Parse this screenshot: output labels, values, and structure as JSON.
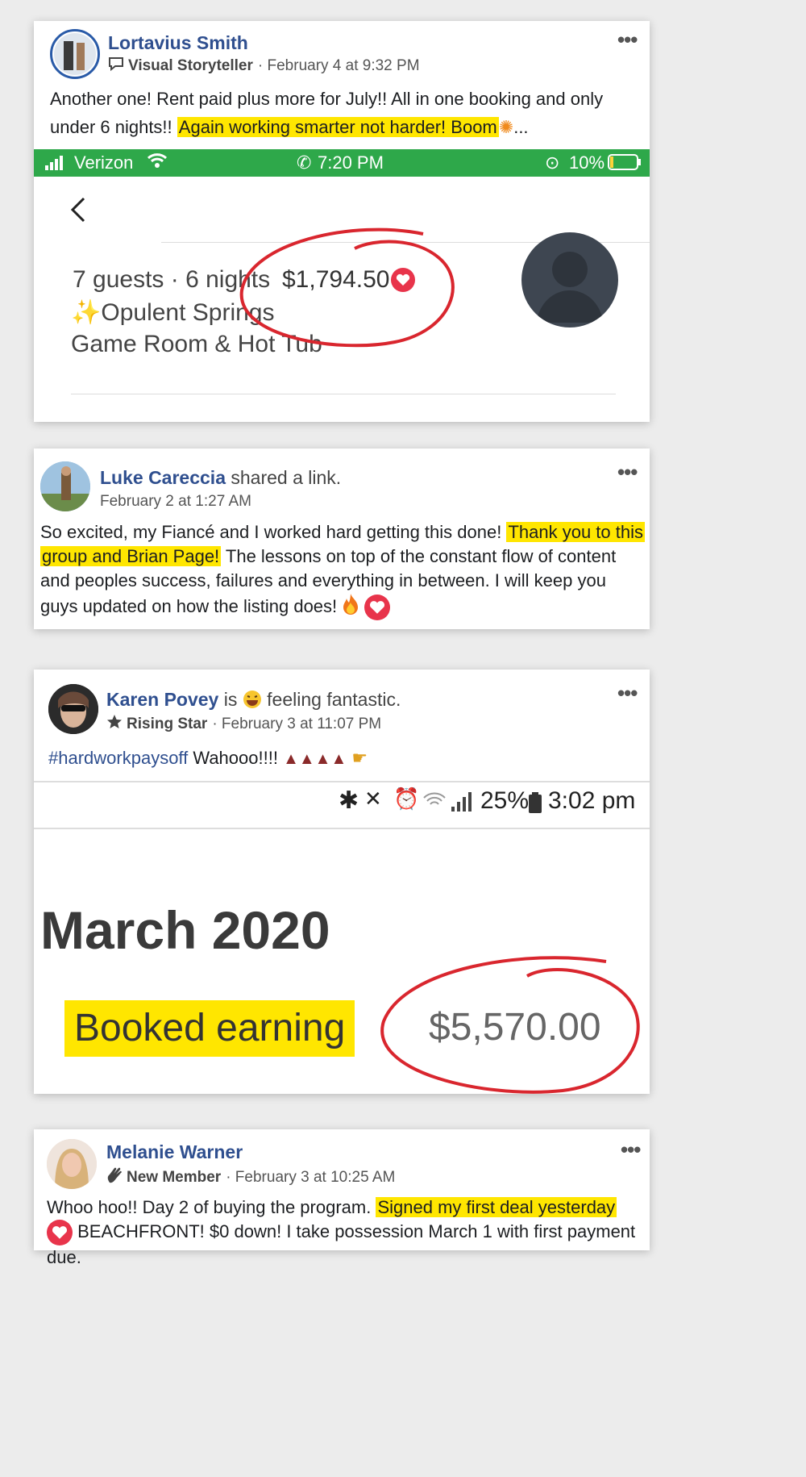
{
  "colors": {
    "link_name": "#2f4f8f",
    "highlight": "#ffe600",
    "heart": "#e8344b",
    "status_green": "#2ea84a",
    "red_circle": "#d9262e"
  },
  "posts": [
    {
      "author": "Lortavius Smith",
      "badge_icon": "speech-bubble-icon",
      "badge": "Visual Storyteller",
      "timestamp": "· February 4 at 9:32 PM",
      "body_plain_1": "Another one! Rent paid plus more for July!! All in one booking and only under 6 nights!!",
      "body_highlight": "Again working smarter not harder! Boom",
      "body_tail": "...",
      "screenshot": {
        "carrier": "Verizon",
        "time": "7:20 PM",
        "battery": "10%",
        "listing_line1": "7 guests · 6 nights",
        "price": "$1,794.50",
        "listing_line2": "Opulent Springs",
        "listing_line3": "Game Room & Hot Tub"
      }
    },
    {
      "author": "Luke Careccia",
      "action": "shared a link.",
      "timestamp": "February 2 at 1:27 AM",
      "body_plain_1": "So excited, my Fiancé and I worked hard getting this done!",
      "body_highlight_a": "Thank you to this",
      "body_highlight_b": "group and Brian Page!",
      "body_plain_2": "The lessons on top of the constant flow of content and peoples success, failures and everything in between. I will keep you guys updated on how the listing does!"
    },
    {
      "author": "Karen Povey",
      "action_is": "is",
      "feeling": "feeling fantastic.",
      "badge_icon": "star-icon",
      "badge": "Rising Star",
      "timestamp": "· February 3 at 11:07 PM",
      "hashtag": "#hardworkpaysoff",
      "body_plain": "Wahooo!!!!",
      "screenshot": {
        "battery": "25%",
        "time": "3:02 pm",
        "month": "March 2020",
        "label": "Booked earning",
        "value": "$5,570.00"
      }
    },
    {
      "author": "Melanie Warner",
      "badge_icon": "waving-hand-icon",
      "badge": "New Member",
      "timestamp": "· February 3 at 10:25 AM",
      "body_plain_1": "Whoo hoo!! Day 2 of buying the program.",
      "body_highlight": "Signed my first deal yesterday",
      "body_plain_2": "BEACHFRONT! $0 down! I take possession March 1 with first payment due."
    }
  ],
  "more_label": "•••"
}
